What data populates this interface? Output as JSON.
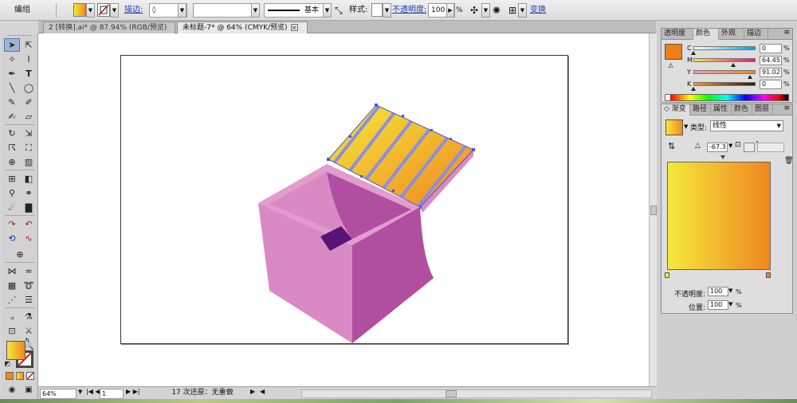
{
  "control_bar": {
    "selection_label": "编组",
    "stroke_label": "描边:",
    "stroke_style": "基本",
    "style_label": "样式:",
    "opacity_label": "不透明度:",
    "opacity_value": "100",
    "opacity_unit": "%",
    "transform_label": "变换"
  },
  "document_tabs": [
    {
      "label": "2 [转换].ai* @ 87.94% (RGB/预览)",
      "active": false
    },
    {
      "label": "未标题-7* @ 64% (CMYK/预览)",
      "active": true
    }
  ],
  "status_bar": {
    "zoom": "64%",
    "page": "1",
    "status_text": "17 次还原：无重做"
  },
  "color_panel": {
    "tabs": [
      "透明度",
      "颜色",
      "外观",
      "描边"
    ],
    "active_tab": "颜色",
    "channels": [
      {
        "label": "C",
        "value": "0",
        "fraction": 0.0,
        "track": [
          "#ffffff",
          "#00a0e9"
        ]
      },
      {
        "label": "M",
        "value": "64.45",
        "fraction": 0.6445,
        "track": [
          "#f7e54a",
          "#e6147f"
        ]
      },
      {
        "label": "Y",
        "value": "91.02",
        "fraction": 0.9102,
        "track": [
          "#f09ab0",
          "#f08a1c"
        ]
      },
      {
        "label": "K",
        "value": "0",
        "fraction": 0.0,
        "track": [
          "#f39a2b",
          "#231815"
        ]
      }
    ],
    "unit": "%",
    "fill_color": "#ef7d1a"
  },
  "gradient_panel": {
    "tabs": [
      "渐变",
      "路径",
      "属性",
      "颜色",
      "图层"
    ],
    "active_tab": "渐变",
    "type_label": "类型:",
    "type_value": "线性",
    "angle": "-67.3",
    "angle_unit": "°",
    "opacity_label": "不透明度:",
    "opacity_value": "100",
    "location_label": "位置:",
    "location_value": "100",
    "unit": "%",
    "start_color": "#f5e93b",
    "end_color": "#ef861f"
  },
  "tools": {
    "fill_color": "#f0a020"
  },
  "colors": {
    "box_light": "#e29cce",
    "box_mid": "#d98ac5",
    "box_dark": "#b04fa0",
    "box_deep": "#5a1477",
    "lid_stripe": "#8a8de6",
    "anchor": "#4a56d8"
  }
}
